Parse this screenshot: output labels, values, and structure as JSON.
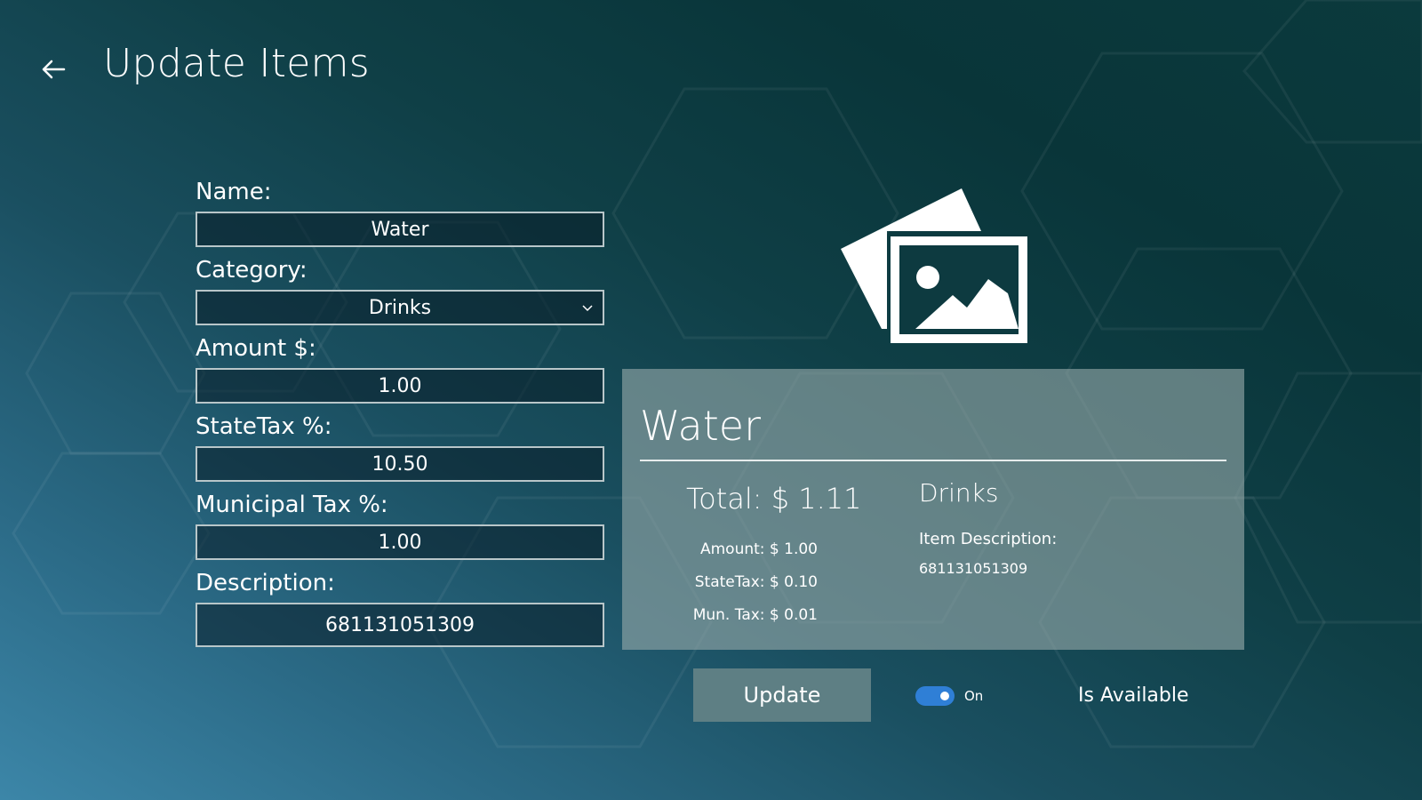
{
  "header": {
    "title": "Update Items",
    "back_icon": "back-arrow-icon"
  },
  "form": {
    "name": {
      "label": "Name:",
      "value": "Water"
    },
    "category": {
      "label": "Category:",
      "value": "Drinks"
    },
    "amount": {
      "label": "Amount $:",
      "value": "1.00"
    },
    "state_tax": {
      "label": "StateTax %:",
      "value": "10.50"
    },
    "municipal_tax": {
      "label": "Municipal Tax %:",
      "value": "1.00"
    },
    "description": {
      "label": "Description:",
      "value": "681131051309"
    }
  },
  "preview": {
    "image_icon": "image-placeholder-icon",
    "name": "Water",
    "total": "Total: $ 1.11",
    "amount_line": "Amount: $ 1.00",
    "state_tax_line": "StateTax: $ 0.10",
    "mun_tax_line": "Mun. Tax: $ 0.01",
    "category": "Drinks",
    "description_label": "Item Description:",
    "description_value": "681131051309"
  },
  "actions": {
    "update_label": "Update",
    "toggle_state": "On",
    "availability_label": "Is Available"
  },
  "colors": {
    "toggle_on": "#2f7fd6",
    "button_bg": "#5e7f84",
    "card_bg": "#8fa5a5"
  }
}
